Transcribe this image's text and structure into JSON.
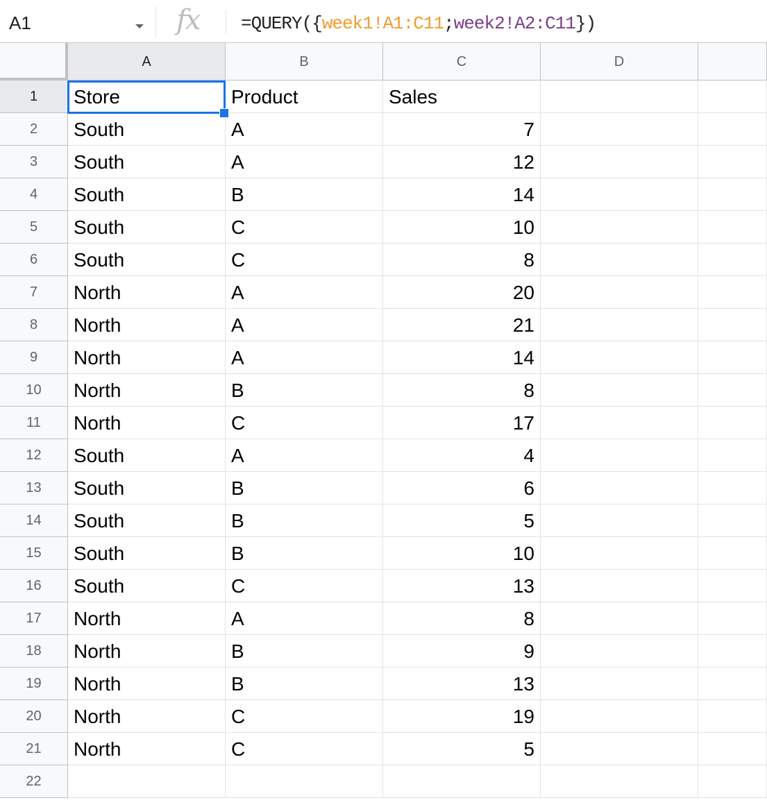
{
  "formula_bar": {
    "name_box": "A1",
    "fx_icon": "fx-icon",
    "formula": {
      "prefix": "=QUERY({",
      "range1": "week1!A1:C11",
      "separator": ";",
      "range2": "week2!A2:C11",
      "suffix": "})"
    }
  },
  "columns": [
    "A",
    "B",
    "C",
    "D"
  ],
  "selected_cell": "A1",
  "rows": [
    {
      "num": "1",
      "store": "Store",
      "product": "Product",
      "sales": "Sales"
    },
    {
      "num": "2",
      "store": "South",
      "product": "A",
      "sales": "7"
    },
    {
      "num": "3",
      "store": "South",
      "product": "A",
      "sales": "12"
    },
    {
      "num": "4",
      "store": "South",
      "product": "B",
      "sales": "14"
    },
    {
      "num": "5",
      "store": "South",
      "product": "C",
      "sales": "10"
    },
    {
      "num": "6",
      "store": "South",
      "product": "C",
      "sales": "8"
    },
    {
      "num": "7",
      "store": "North",
      "product": "A",
      "sales": "20"
    },
    {
      "num": "8",
      "store": "North",
      "product": "A",
      "sales": "21"
    },
    {
      "num": "9",
      "store": "North",
      "product": "A",
      "sales": "14"
    },
    {
      "num": "10",
      "store": "North",
      "product": "B",
      "sales": "8"
    },
    {
      "num": "11",
      "store": "North",
      "product": "C",
      "sales": "17"
    },
    {
      "num": "12",
      "store": "South",
      "product": "A",
      "sales": "4"
    },
    {
      "num": "13",
      "store": "South",
      "product": "B",
      "sales": "6"
    },
    {
      "num": "14",
      "store": "South",
      "product": "B",
      "sales": "5"
    },
    {
      "num": "15",
      "store": "South",
      "product": "B",
      "sales": "10"
    },
    {
      "num": "16",
      "store": "South",
      "product": "C",
      "sales": "13"
    },
    {
      "num": "17",
      "store": "North",
      "product": "A",
      "sales": "8"
    },
    {
      "num": "18",
      "store": "North",
      "product": "B",
      "sales": "9"
    },
    {
      "num": "19",
      "store": "North",
      "product": "B",
      "sales": "13"
    },
    {
      "num": "20",
      "store": "North",
      "product": "C",
      "sales": "19"
    },
    {
      "num": "21",
      "store": "North",
      "product": "C",
      "sales": "5"
    },
    {
      "num": "22",
      "store": "",
      "product": "",
      "sales": ""
    }
  ],
  "colors": {
    "range1": "#f09b2c",
    "range2": "#7b3c8a",
    "selection": "#1a73e8"
  }
}
